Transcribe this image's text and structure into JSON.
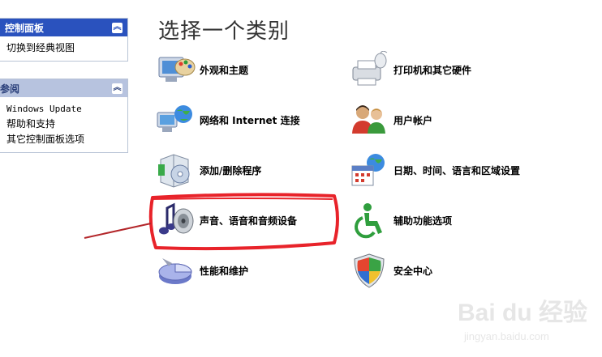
{
  "colors": {
    "pane_head_1": "#2a52be",
    "pane_head_2": "#7d8bb6",
    "pane_head_2_bg": "#b7c3df",
    "annotation": "#e8232a"
  },
  "left_pane": [
    {
      "header": "控制面板",
      "items": [
        "切换到经典视图"
      ]
    },
    {
      "header": "参阅",
      "items": [
        "Windows Update",
        "帮助和支持",
        "其它控制面板选项"
      ]
    }
  ],
  "main": {
    "title": "选择一个类别",
    "categories": [
      {
        "label": "外观和主题",
        "icon": "appearance-icon"
      },
      {
        "label": "打印机和其它硬件",
        "icon": "printer-icon"
      },
      {
        "label": "网络和 Internet 连接",
        "icon": "network-icon"
      },
      {
        "label": "用户帐户",
        "icon": "users-icon"
      },
      {
        "label": "添加/删除程序",
        "icon": "add-remove-icon"
      },
      {
        "label": "日期、时间、语言和区域设置",
        "icon": "calendar-globe-icon"
      },
      {
        "label": "声音、语音和音频设备",
        "icon": "sound-icon"
      },
      {
        "label": "辅助功能选项",
        "icon": "accessibility-icon"
      },
      {
        "label": "性能和维护",
        "icon": "performance-icon"
      },
      {
        "label": "安全中心",
        "icon": "security-shield-icon"
      }
    ]
  },
  "watermark": {
    "text": "Bai du 经验",
    "url_text": "jingyan.baidu.com"
  }
}
